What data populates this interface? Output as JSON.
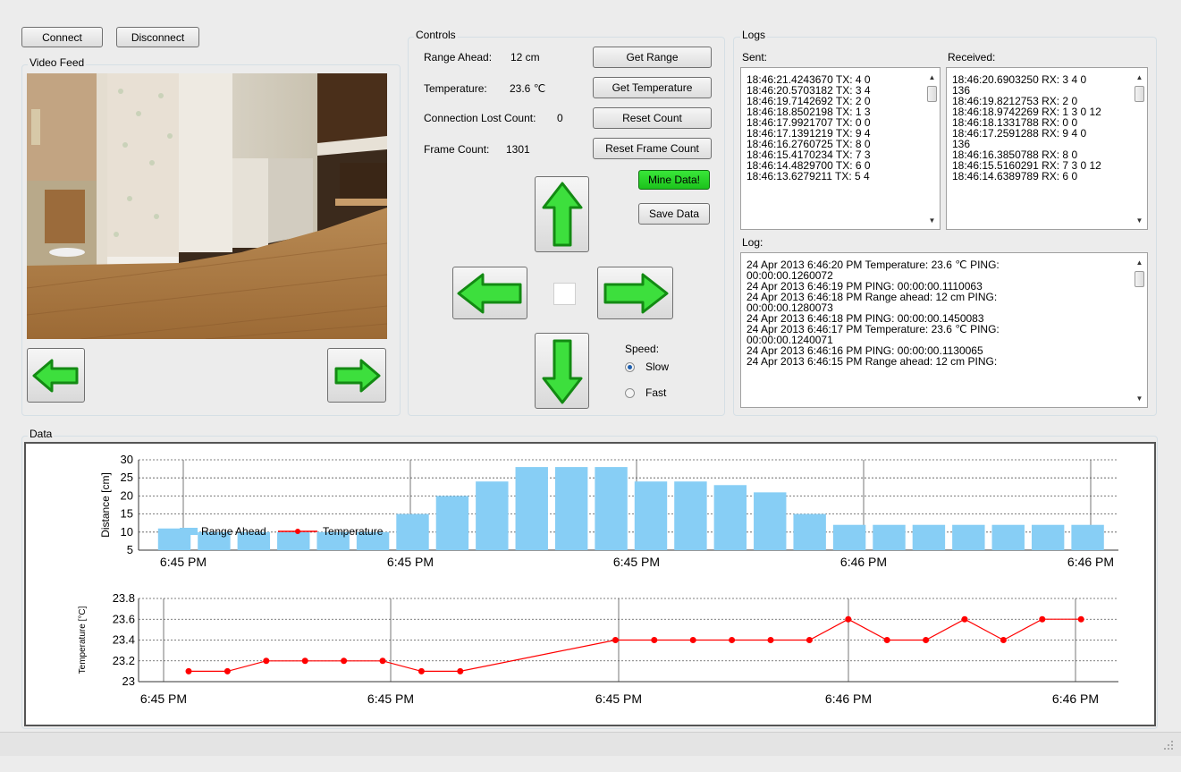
{
  "toolbar": {
    "connect_label": "Connect",
    "disconnect_label": "Disconnect"
  },
  "video": {
    "group_label": "Video Feed",
    "left_icon": "arrow-left-icon",
    "right_icon": "arrow-right-icon"
  },
  "controls": {
    "group_label": "Controls",
    "range_label": "Range Ahead:",
    "range_value": "12 cm",
    "temp_label": "Temperature:",
    "temp_value": "23.6 ℃",
    "lost_label": "Connection Lost Count:",
    "lost_value": "0",
    "frame_label": "Frame Count:",
    "frame_value": "1301",
    "get_range": "Get Range",
    "get_temperature": "Get Temperature",
    "reset_count": "Reset Count",
    "reset_frame_count": "Reset Frame Count",
    "mine_data": "Mine Data!",
    "save_data": "Save Data",
    "speed_label": "Speed:",
    "speed_options": [
      "Slow",
      "Fast"
    ],
    "speed_selected": "Slow",
    "accent_green": "#22cc22"
  },
  "logs": {
    "group_label": "Logs",
    "sent_label": "Sent:",
    "received_label": "Received:",
    "log_label": "Log:",
    "sent": [
      "18:46:21.4243670  TX: 4 0",
      "18:46:20.5703182  TX: 3 4",
      "18:46:19.7142692  TX: 2 0",
      "18:46:18.8502198  TX: 1 3",
      "18:46:17.9921707  TX: 0 0",
      "18:46:17.1391219  TX: 9 4",
      "18:46:16.2760725  TX: 8 0",
      "18:46:15.4170234  TX: 7 3",
      "18:46:14.4829700  TX: 6 0",
      "18:46:13.6279211  TX: 5 4"
    ],
    "received": [
      "18:46:20.6903250  RX: 3 4 0",
      "136",
      "18:46:19.8212753  RX: 2 0",
      "18:46:18.9742269  RX: 1 3 0 12",
      "18:46:18.1331788  RX: 0 0",
      "18:46:17.2591288  RX: 9 4 0",
      "136",
      "18:46:16.3850788  RX: 8 0",
      "18:46:15.5160291  RX: 7 3 0 12",
      "18:46:14.6389789  RX: 6 0"
    ],
    "log": [
      "24 Apr 2013 6:46:20 PM  Temperature: 23.6 ℃ PING:",
      "00:00:00.1260072",
      "24 Apr 2013 6:46:19 PM  PING: 00:00:00.1110063",
      "24 Apr 2013 6:46:18 PM  Range ahead: 12 cm PING:",
      "00:00:00.1280073",
      "24 Apr 2013 6:46:18 PM  PING: 00:00:00.1450083",
      "24 Apr 2013 6:46:17 PM  Temperature: 23.6 ℃ PING:",
      "00:00:00.1240071",
      "24 Apr 2013 6:46:16 PM  PING: 00:00:00.1130065",
      "24 Apr 2013 6:46:15 PM  Range ahead: 12 cm PING:"
    ]
  },
  "data_group_label": "Data",
  "chart_data": [
    {
      "type": "bar",
      "ylabel": "Distance [cm]",
      "ylim": [
        5,
        30
      ],
      "yticks": [
        5,
        10,
        15,
        20,
        25,
        30
      ],
      "xtick_labels": [
        "6:45 PM",
        "6:45 PM",
        "6:45 PM",
        "6:46 PM",
        "6:46 PM"
      ],
      "grid": true,
      "legend": [
        "Range Ahead",
        "Temperature"
      ],
      "legend_placement": "bottom-left",
      "series": [
        {
          "name": "Range Ahead",
          "color": "#87cef5",
          "values": [
            11,
            10,
            10,
            10,
            10,
            10,
            15,
            20,
            24,
            28,
            28,
            28,
            24,
            24,
            23,
            21,
            15,
            12,
            12,
            12,
            12,
            12,
            12,
            12
          ]
        }
      ]
    },
    {
      "type": "line",
      "ylabel": "Temperature [°C]",
      "ylim": [
        23,
        23.8
      ],
      "yticks": [
        23,
        23.2,
        23.4,
        23.6,
        23.8
      ],
      "xtick_labels": [
        "6:45 PM",
        "6:45 PM",
        "6:45 PM",
        "6:46 PM",
        "6:46 PM"
      ],
      "grid": true,
      "series": [
        {
          "name": "Temperature",
          "color": "#ff0000",
          "values": [
            23.1,
            23.1,
            23.2,
            23.2,
            23.2,
            23.2,
            23.1,
            23.1,
            23.4,
            23.4,
            23.4,
            23.4,
            23.4,
            23.4,
            23.6,
            23.4,
            23.4,
            23.6,
            23.4,
            23.6,
            23.6
          ]
        }
      ]
    }
  ]
}
